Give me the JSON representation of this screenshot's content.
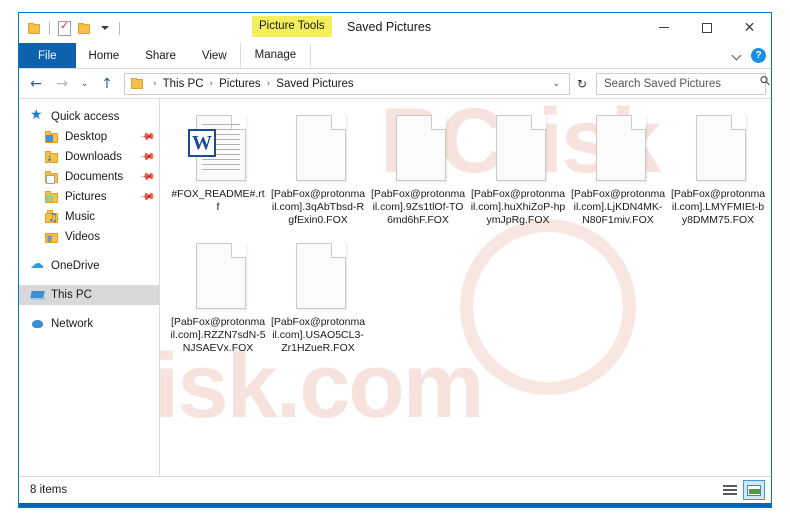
{
  "window": {
    "title": "Saved Pictures",
    "contextual_tab_group": "Picture Tools",
    "accent_color": "#0078d7",
    "highlight_color": "#f3ee5c"
  },
  "quick_access_toolbar": {
    "items": [
      {
        "name": "folder-icon",
        "tooltip": "Saved Pictures"
      },
      {
        "name": "properties-icon",
        "tooltip": "Properties"
      },
      {
        "name": "new-folder-icon",
        "tooltip": "New folder"
      },
      {
        "name": "chevron-down-icon",
        "tooltip": "Customize Quick Access Toolbar"
      }
    ]
  },
  "window_controls": {
    "minimize": "–",
    "maximize": "□",
    "close": "✕"
  },
  "ribbon": {
    "tabs": [
      {
        "label": "File",
        "active": false,
        "style": "file"
      },
      {
        "label": "Home",
        "active": false,
        "style": "normal"
      },
      {
        "label": "Share",
        "active": false,
        "style": "normal"
      },
      {
        "label": "View",
        "active": false,
        "style": "normal"
      },
      {
        "label": "Manage",
        "active": true,
        "style": "contextual"
      }
    ],
    "collapse_icon": "chevron-down-icon",
    "help_label": "?"
  },
  "navigation": {
    "back": "←",
    "forward": "→",
    "recent_locations": "⌄",
    "up": "↑",
    "breadcrumb": [
      "This PC",
      "Pictures",
      "Saved Pictures"
    ],
    "separator": "›",
    "dropdown": "⌄",
    "refresh": "↻"
  },
  "search": {
    "placeholder": "Search Saved Pictures",
    "value": "",
    "icon": "search-icon"
  },
  "sidebar": {
    "groups": [
      {
        "items": [
          {
            "label": "Quick access",
            "icon": "star-icon",
            "level": "root",
            "pinned": false,
            "selected": false
          },
          {
            "label": "Desktop",
            "icon": "desktop-folder-icon",
            "level": "child",
            "pinned": true,
            "selected": false
          },
          {
            "label": "Downloads",
            "icon": "downloads-folder-icon",
            "level": "child",
            "pinned": true,
            "selected": false
          },
          {
            "label": "Documents",
            "icon": "documents-folder-icon",
            "level": "child",
            "pinned": true,
            "selected": false
          },
          {
            "label": "Pictures",
            "icon": "pictures-folder-icon",
            "level": "child",
            "pinned": true,
            "selected": false
          },
          {
            "label": "Music",
            "icon": "music-folder-icon",
            "level": "child",
            "pinned": false,
            "selected": false
          },
          {
            "label": "Videos",
            "icon": "videos-folder-icon",
            "level": "child",
            "pinned": false,
            "selected": false
          }
        ]
      },
      {
        "items": [
          {
            "label": "OneDrive",
            "icon": "cloud-icon",
            "level": "root",
            "pinned": false,
            "selected": false
          }
        ]
      },
      {
        "items": [
          {
            "label": "This PC",
            "icon": "this-pc-icon",
            "level": "root",
            "pinned": false,
            "selected": true
          }
        ]
      },
      {
        "items": [
          {
            "label": "Network",
            "icon": "network-icon",
            "level": "root",
            "pinned": false,
            "selected": false
          }
        ]
      }
    ]
  },
  "files": [
    {
      "name": "#FOX_README#.rtf",
      "icon": "word-document-icon",
      "badge": "W"
    },
    {
      "name": "[PabFox@protonmail.com].3qAbTbsd-RgfExin0.FOX",
      "icon": "generic-file-icon",
      "badge": ""
    },
    {
      "name": "[PabFox@protonmail.com].9Zs1tlOf-TO6md6hF.FOX",
      "icon": "generic-file-icon",
      "badge": ""
    },
    {
      "name": "[PabFox@protonmail.com].huXhiZoP-hpymJpRg.FOX",
      "icon": "generic-file-icon",
      "badge": ""
    },
    {
      "name": "[PabFox@protonmail.com].LjKDN4MK-N80F1miv.FOX",
      "icon": "generic-file-icon",
      "badge": ""
    },
    {
      "name": "[PabFox@protonmail.com].LMYFMIEt-by8DMM75.FOX",
      "icon": "generic-file-icon",
      "badge": ""
    },
    {
      "name": "[PabFox@protonmail.com].RZZN7sdN-5NJSAEVx.FOX",
      "icon": "generic-file-icon",
      "badge": ""
    },
    {
      "name": "[PabFox@protonmail.com].USAO5CL3-Zr1HZueR.FOX",
      "icon": "generic-file-icon",
      "badge": ""
    }
  ],
  "watermark": {
    "line1": "PCrisk",
    "line2": "risk.com"
  },
  "status_bar": {
    "item_count": "8 items",
    "views": [
      {
        "name": "details-view-button",
        "active": false
      },
      {
        "name": "large-icons-view-button",
        "active": true
      }
    ]
  }
}
